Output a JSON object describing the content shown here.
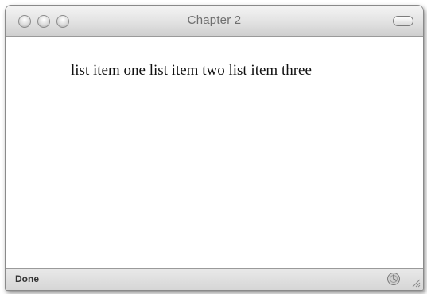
{
  "window": {
    "title": "Chapter 2"
  },
  "content": {
    "list_items": [
      "list item one",
      "list item two",
      "list item three"
    ]
  },
  "statusbar": {
    "status_text": "Done"
  },
  "colors": {
    "titlebar": "#dedede",
    "content_bg": "#ffffff",
    "text": "#111111"
  },
  "icons": {
    "close": "close-button",
    "minimize": "minimize-button",
    "zoom": "zoom-button",
    "toolbar_toggle": "toolbar-toggle",
    "security": "lock-status-icon",
    "resize": "resize-grip"
  }
}
